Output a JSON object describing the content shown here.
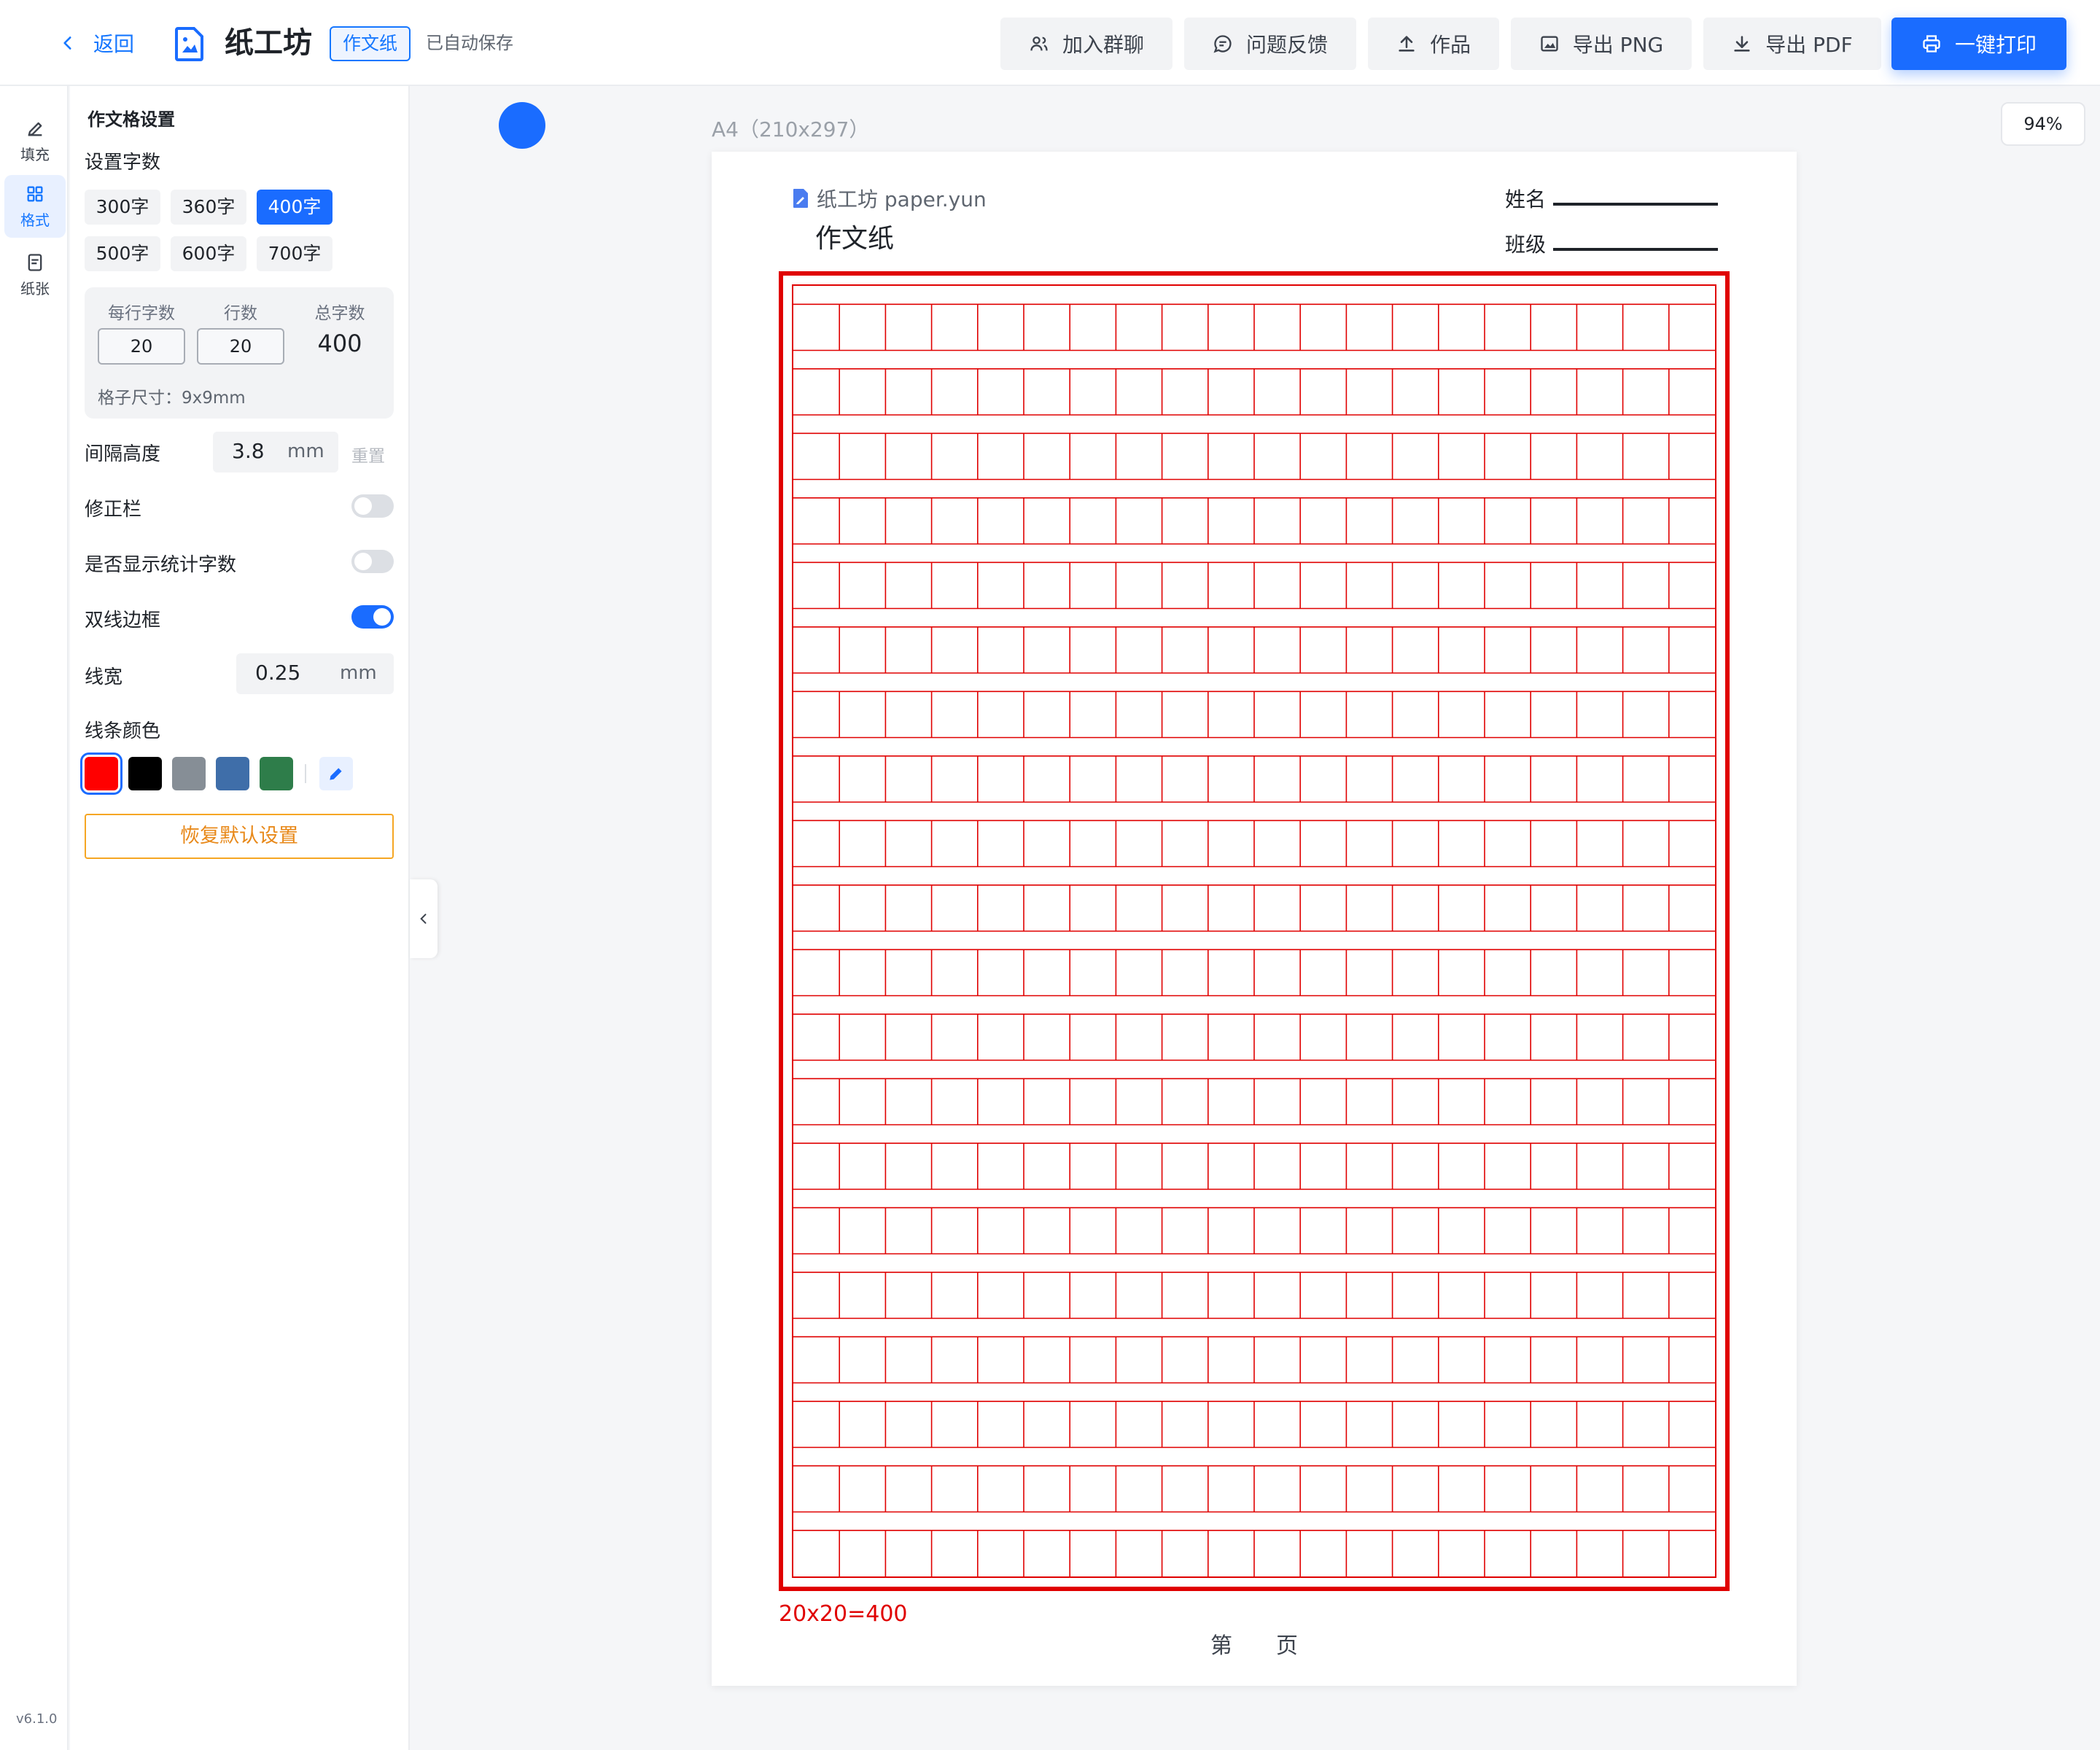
{
  "header": {
    "back_label": "返回",
    "app_title": "纸工坊",
    "doc_type": "作文纸",
    "saved_status": "已自动保存",
    "buttons": {
      "join_group": "加入群聊",
      "feedback": "问题反馈",
      "works": "作品",
      "export_png": "导出 PNG",
      "export_pdf": "导出 PDF",
      "print": "一键打印"
    }
  },
  "rail": {
    "items": [
      {
        "label": "填充",
        "icon": "pencil-icon"
      },
      {
        "label": "格式",
        "icon": "grid-icon"
      },
      {
        "label": "纸张",
        "icon": "paper-icon"
      }
    ],
    "version": "v6.1.0"
  },
  "settings": {
    "title": "作文格设置",
    "count_label": "设置字数",
    "count_options": [
      "300字",
      "360字",
      "400字",
      "500字",
      "600字",
      "700字"
    ],
    "count_selected": "400字",
    "per_line_label": "每行字数",
    "rows_label": "行数",
    "total_label": "总字数",
    "per_line_value": "20",
    "rows_value": "20",
    "total_value": "400",
    "cell_size": "格子尺寸：9x9mm",
    "gap_label": "间隔高度",
    "gap_value": "3.8",
    "gap_unit": "mm",
    "gap_reset": "重置",
    "correction_label": "修正栏",
    "correction_on": false,
    "show_count_label": "是否显示统计字数",
    "show_count_on": false,
    "double_border_label": "双线边框",
    "double_border_on": true,
    "line_width_label": "线宽",
    "line_width_value": "0.25",
    "line_width_unit": "mm",
    "line_color_label": "线条颜色",
    "colors": [
      "#ff0000",
      "#000000",
      "#868e96",
      "#3f6ea9",
      "#2e7d4a"
    ],
    "selected_color": "#ff0000",
    "restore_label": "恢复默认设置"
  },
  "canvas": {
    "paper_size": "A4（210x297）",
    "zoom": "94%"
  },
  "paper": {
    "brand": "纸工坊 paper.yun",
    "title": "作文纸",
    "name_label": "姓名",
    "class_label": "班级",
    "columns": 20,
    "rows": 20,
    "line_color": "#e00000",
    "count_text": "20x20=400",
    "page_text": "第　　页"
  }
}
